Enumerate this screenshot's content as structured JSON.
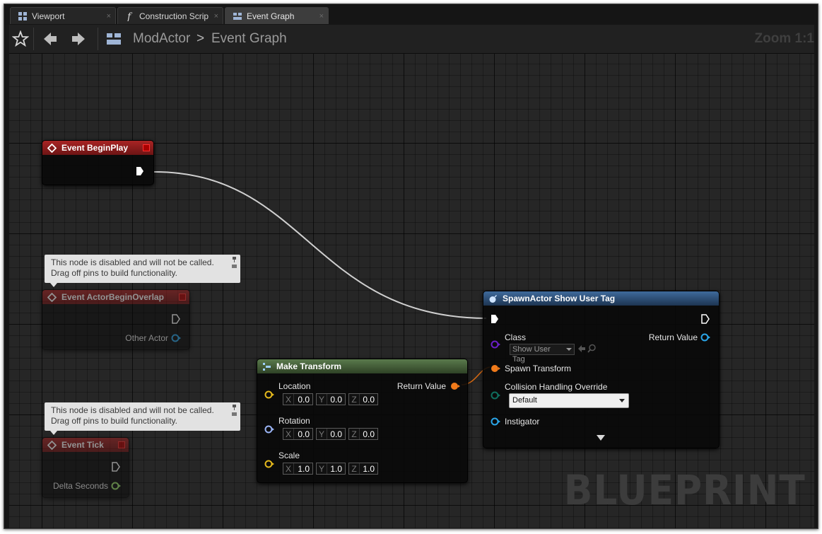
{
  "tabs": [
    {
      "label": "Viewport",
      "icon": "viewport-icon",
      "close": "×"
    },
    {
      "label": "Construction Scrip",
      "icon": "function-icon",
      "close": "×"
    },
    {
      "label": "Event Graph",
      "icon": "event-graph-icon",
      "close": "×"
    }
  ],
  "toolbar": {
    "breadcrumb_root": "ModActor",
    "breadcrumb_separator": ">",
    "breadcrumb_current": "Event Graph",
    "zoom": "Zoom 1:1"
  },
  "watermark": "BLUEPRINT",
  "comment": {
    "line1": "This node is disabled and will not be called.",
    "line2": "Drag off pins to build functionality."
  },
  "nodes": {
    "begin_play": {
      "title": "Event BeginPlay"
    },
    "actor_begin_overlap": {
      "title": "Event ActorBeginOverlap",
      "pin_other_actor": "Other Actor"
    },
    "tick": {
      "title": "Event Tick",
      "pin_delta_seconds": "Delta Seconds"
    },
    "make_transform": {
      "title": "Make Transform",
      "return_value": "Return Value",
      "location": {
        "label": "Location",
        "x": "0.0",
        "y": "0.0",
        "z": "0.0"
      },
      "rotation": {
        "label": "Rotation",
        "x": "0.0",
        "y": "0.0",
        "z": "0.0"
      },
      "scale": {
        "label": "Scale",
        "x": "1.0",
        "y": "1.0",
        "z": "1.0"
      },
      "axis_x": "X",
      "axis_y": "Y",
      "axis_z": "Z"
    },
    "spawn_actor": {
      "title": "SpawnActor Show User Tag",
      "class_label": "Class",
      "class_value": "Show User Tag",
      "return_value": "Return Value",
      "spawn_transform": "Spawn Transform",
      "collision_label": "Collision Handling Override",
      "collision_value": "Default",
      "instigator": "Instigator"
    }
  },
  "colors": {
    "event_header": "#8b1c1c",
    "function_header": "#2b4a6d",
    "struct_header": "#3f5a33",
    "exec_wire": "#d8d8d8",
    "transform_pin": "#f07a1a",
    "vector_pin": "#e5b91c",
    "rotator_pin": "#9ab4f5",
    "object_pin": "#2aa5e8",
    "class_pin": "#6a1fc7",
    "float_pin": "#9be06a",
    "enum_pin": "#0f6e5e"
  }
}
